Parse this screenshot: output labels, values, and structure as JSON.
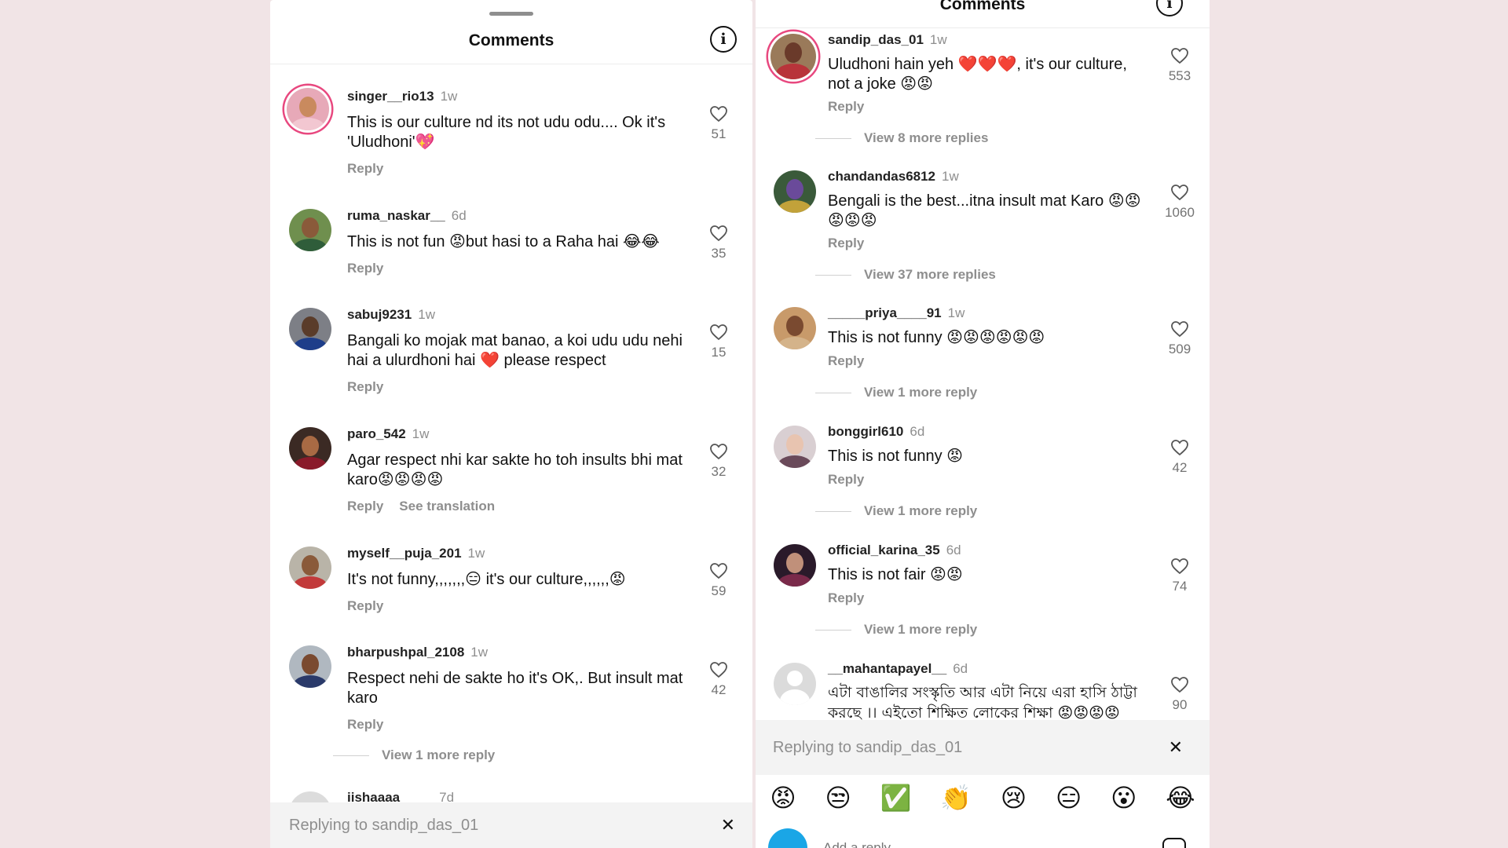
{
  "left": {
    "title": "Comments",
    "comments": [
      {
        "user": "singer__rio13",
        "time": "1w",
        "text": "This is our culture nd its not udu odu.... Ok it's 'Uludhoni'💖",
        "likes": "51",
        "actions": [
          "Reply"
        ]
      },
      {
        "user": "ruma_naskar__",
        "time": "6d",
        "text": "This is not fun 😡but hasi to a Raha hai 😂😂",
        "likes": "35",
        "actions": [
          "Reply"
        ]
      },
      {
        "user": "sabuj9231",
        "time": "1w",
        "text": "Bangali ko mojak mat banao, a koi udu udu nehi hai a ulurdhoni hai ❤️ please respect",
        "likes": "15",
        "actions": [
          "Reply"
        ]
      },
      {
        "user": "paro_542",
        "time": "1w",
        "text": "Agar respect nhi kar sakte ho toh insults bhi mat karo😡😡😡😡",
        "likes": "32",
        "actions": [
          "Reply",
          "See translation"
        ]
      },
      {
        "user": "myself__puja_201",
        "time": "1w",
        "text": "It's not funny,,,,,,,😑 it's our culture,,,,,,😡",
        "likes": "59",
        "actions": [
          "Reply"
        ]
      },
      {
        "user": "bharpushpal_2108",
        "time": "1w",
        "text": "Respect nehi de sakte ho it's OK,. But insult mat karo",
        "likes": "42",
        "actions": [
          "Reply"
        ]
      }
    ],
    "view_more": "View 1 more reply",
    "partial_user": "iishaaaa",
    "partial_time": "7d",
    "replying_to": "Replying to sandip_das_01"
  },
  "right": {
    "title": "Comments",
    "comments": [
      {
        "user": "sandip_das_01",
        "time": "1w",
        "text": "Uludhoni hain yeh ❤️❤️❤️, it's our culture, not a joke 😡😡",
        "likes": "553",
        "reply": "Reply",
        "more": "View 8 more replies"
      },
      {
        "user": "chandandas6812",
        "time": "1w",
        "text": "Bengali is the best...itna insult mat Karo 😡😡😡😡😡",
        "likes": "1060",
        "reply": "Reply",
        "more": "View 37 more replies"
      },
      {
        "user": "_____priya____91",
        "time": "1w",
        "text": "This is not funny 😡😡😡😡😡😡",
        "likes": "509",
        "reply": "Reply",
        "more": "View 1 more reply"
      },
      {
        "user": "bonggirl610",
        "time": "6d",
        "text": "This is not funny 😡",
        "likes": "42",
        "reply": "Reply",
        "more": "View 1 more reply"
      },
      {
        "user": "official_karina_35",
        "time": "6d",
        "text": "This is not fair 😡😡",
        "likes": "74",
        "reply": "Reply",
        "more": "View 1 more reply"
      },
      {
        "user": "__mahantapayel__",
        "time": "6d",
        "text": "এটা বাঙালির সংস্কৃতি আর এটা নিয়ে এরা হাসি ঠাট্টা করছে ।। এইতো শিক্ষিত লোকের শিক্ষা 😡😡😡😡",
        "likes": "90"
      }
    ],
    "replying_to": "Replying to sandip_das_01",
    "emojis": [
      "😡",
      "😒",
      "✅",
      "👏",
      "😢",
      "😑",
      "😮",
      "😂"
    ],
    "compose_placeholder": "Add a reply..."
  },
  "colors": {
    "background": "#f1e4e6",
    "ring": "#e8487f",
    "muted": "#8e8e8e"
  }
}
